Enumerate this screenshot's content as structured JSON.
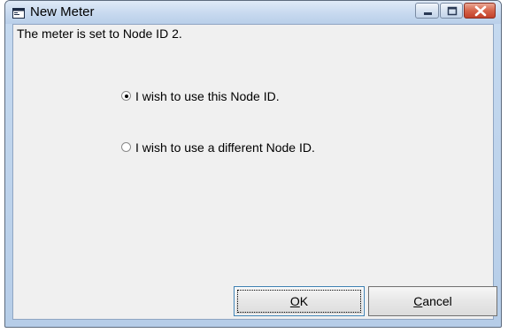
{
  "window": {
    "title": "New Meter",
    "controls": {
      "minimize": "minimize-icon",
      "maximize": "maximize-icon",
      "close": "close-icon"
    }
  },
  "dialog": {
    "message": "The meter is set to Node ID 2.",
    "options": [
      {
        "label": "I wish to use this Node ID.",
        "selected": true
      },
      {
        "label": "I wish to use a different Node ID.",
        "selected": false
      }
    ],
    "buttons": {
      "ok": {
        "mnemonic": "O",
        "rest": "K"
      },
      "cancel": {
        "mnemonic": "C",
        "rest": "ancel"
      }
    }
  }
}
